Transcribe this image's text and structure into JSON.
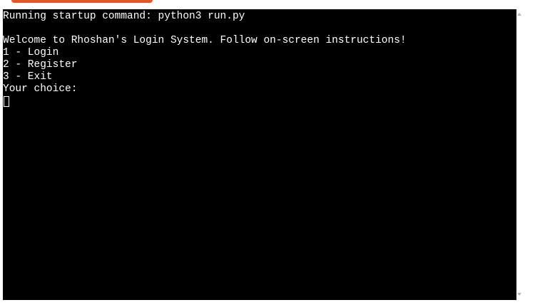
{
  "terminal": {
    "lines": [
      "Running startup command: python3 run.py",
      "",
      "Welcome to Rhoshan's Login System. Follow on-screen instructions!",
      "1 - Login",
      "2 - Register",
      "3 - Exit",
      "Your choice:"
    ]
  },
  "colors": {
    "terminal_background": "#000000",
    "terminal_text": "#ffffff",
    "run_button_accent": "#e2562c"
  }
}
